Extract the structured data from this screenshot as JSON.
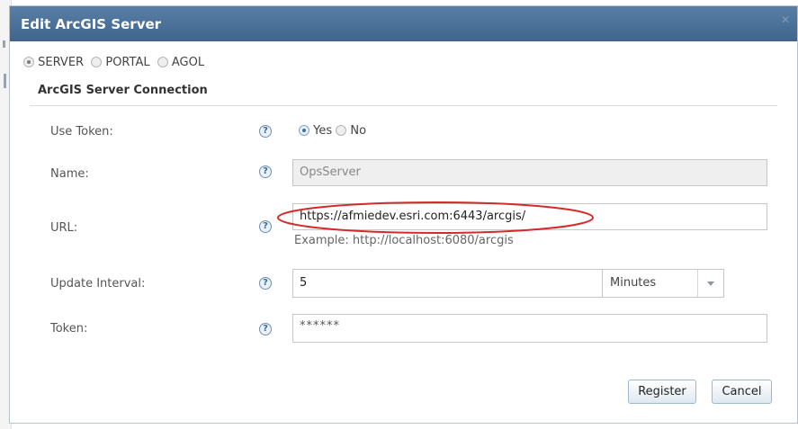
{
  "dialog": {
    "title": "Edit ArcGIS Server",
    "close_glyph": "✕"
  },
  "modes": [
    {
      "label": "SERVER",
      "selected": true
    },
    {
      "label": "PORTAL",
      "selected": false
    },
    {
      "label": "AGOL",
      "selected": false
    }
  ],
  "section": {
    "title": "ArcGIS Server Connection"
  },
  "form": {
    "use_token": {
      "label": "Use Token:",
      "yes": "Yes",
      "no": "No",
      "value": "Yes"
    },
    "name": {
      "label": "Name:",
      "value": "OpsServer"
    },
    "url": {
      "label": "URL:",
      "value": "https://afmiedev.esri.com:6443/arcgis/",
      "example": "Example: http://localhost:6080/arcgis"
    },
    "update_interval": {
      "label": "Update Interval:",
      "value": "5",
      "unit": "Minutes"
    },
    "token": {
      "label": "Token:",
      "value": "******"
    }
  },
  "help_glyph": "?",
  "buttons": {
    "register": "Register",
    "cancel": "Cancel"
  },
  "colors": {
    "titlebar": "#4a7098",
    "annotation": "#d42a2a",
    "help": "#3a6a9a"
  }
}
